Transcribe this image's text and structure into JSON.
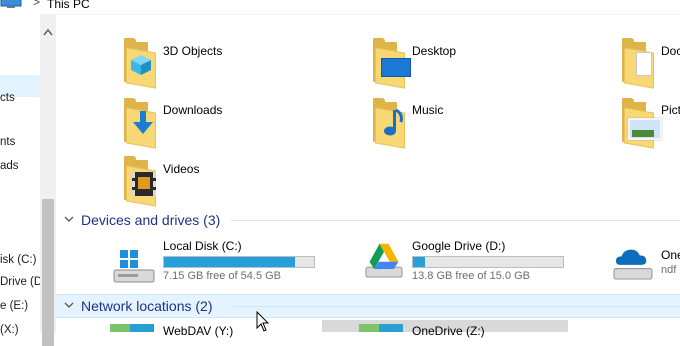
{
  "address_bar": {
    "separator": ">",
    "crumb": "This PC"
  },
  "nav_items": [
    {
      "label": "cts"
    },
    {
      "label": "nts"
    },
    {
      "label": "ads"
    },
    {
      "label": "isk (C:)"
    },
    {
      "label": "Drive (D:"
    },
    {
      "label": "e (E:)"
    },
    {
      "label": "(X:)"
    }
  ],
  "folders": [
    {
      "name": "3D Objects",
      "icon": "3d-objects-icon"
    },
    {
      "name": "Desktop",
      "icon": "desktop-icon"
    },
    {
      "name": "Doc",
      "icon": "documents-icon"
    },
    {
      "name": "Downloads",
      "icon": "downloads-icon"
    },
    {
      "name": "Music",
      "icon": "music-icon"
    },
    {
      "name": "Pict",
      "icon": "pictures-icon"
    },
    {
      "name": "Videos",
      "icon": "videos-icon"
    }
  ],
  "sections": {
    "devices": "Devices and drives (3)",
    "network": "Network locations (2)"
  },
  "drives": [
    {
      "name": "Local Disk (C:)",
      "free_text": "7.15 GB free of 54.5 GB",
      "used_fraction": 0.87,
      "icon": "hard-disk-icon"
    },
    {
      "name": "Google Drive (D:)",
      "free_text": "13.8 GB free of 15.0 GB",
      "used_fraction": 0.08,
      "icon": "google-drive-icon"
    },
    {
      "name": "One",
      "free_text": "ndf",
      "used_fraction": null,
      "icon": "onedrive-icon"
    }
  ],
  "network_locations": [
    {
      "name": "WebDAV (Y:)"
    },
    {
      "name": "OneDrive (Z:)"
    }
  ],
  "colors": {
    "bar_fill": "#26a0da",
    "section_title": "#1e3287",
    "folder": "#f8d775"
  }
}
